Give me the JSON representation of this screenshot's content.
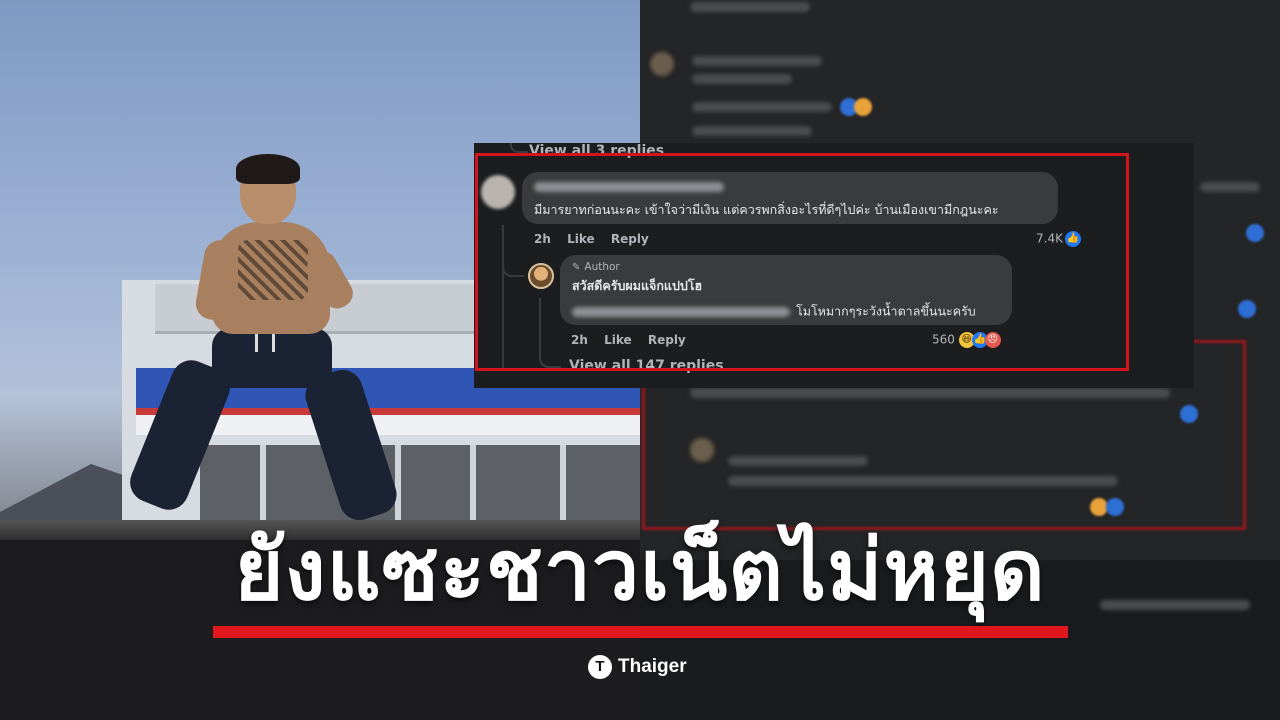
{
  "comment_card": {
    "replies_top_label": "View all 3 replies",
    "comment": {
      "text": "มีมารยาทก่อนนะคะ เข้าใจว่ามีเงิน แต่ควรพกสิ่งอะไรที่ดีๆไปค่ะ บ้านเมืองเขามีกฎนะคะ",
      "time": "2h",
      "like_label": "Like",
      "reply_label": "Reply",
      "reaction_count": "7.4K"
    },
    "reply": {
      "badge": "Author",
      "name": "สวัสดีครับผมแจ็กแปปโฮ",
      "text": "โมโหมากๆระวังน้ำตาลขึ้นนะครับ",
      "time": "2h",
      "like_label": "Like",
      "reply_label": "Reply",
      "reaction_count": "560"
    },
    "view_all_replies_label": "View all 147 replies"
  },
  "headline": "ยังแซะชาวเน็ตไม่หยุด",
  "logo": {
    "mark": "T",
    "text": "Thaiger"
  },
  "colors": {
    "accent_red": "#e0171d",
    "card_bg": "#1c1d1f",
    "bubble_bg": "#3a3b3c",
    "like_blue": "#2078f4"
  }
}
